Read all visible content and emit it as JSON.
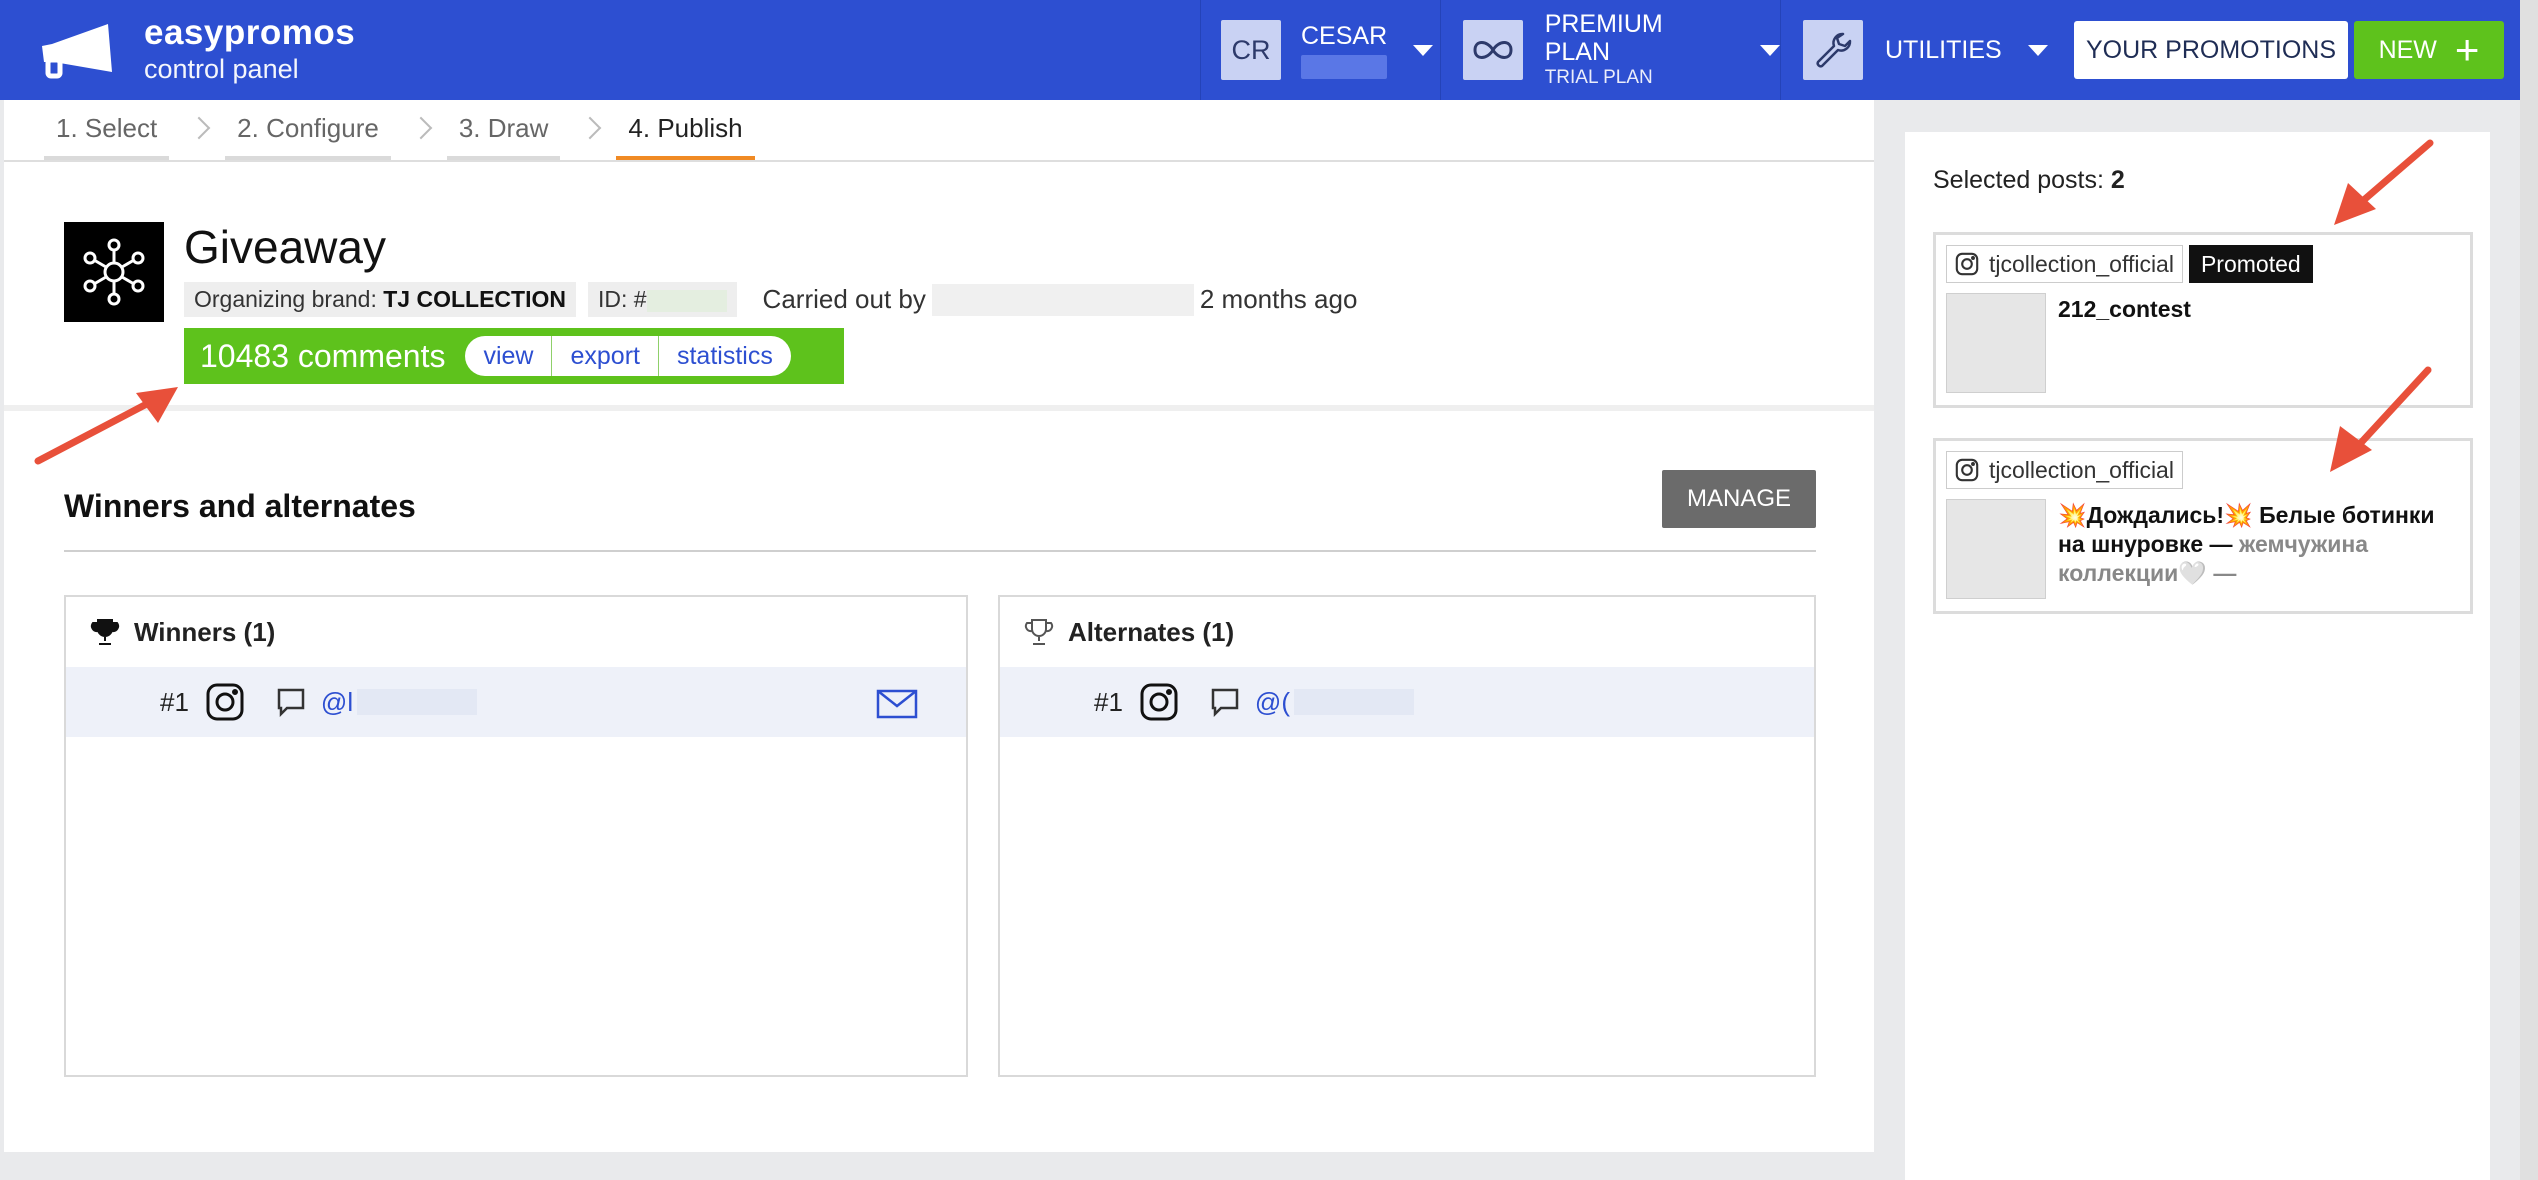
{
  "brand": {
    "name": "easypromos",
    "subtitle": "control panel"
  },
  "user": {
    "initials": "CR",
    "name": "CESAR"
  },
  "plan": {
    "title": "PREMIUM PLAN",
    "subtitle": "TRIAL PLAN"
  },
  "utilities": {
    "label": "UTILITIES"
  },
  "buttons": {
    "your_promotions": "YOUR PROMOTIONS",
    "new": "NEW",
    "new_plus": "+",
    "manage": "MANAGE"
  },
  "steps": [
    {
      "label": "1. Select"
    },
    {
      "label": "2. Configure"
    },
    {
      "label": "3. Draw"
    },
    {
      "label": "4. Publish"
    }
  ],
  "promotion": {
    "title": "Giveaway",
    "brand_label": "Organizing brand:",
    "brand_value": "TJ COLLECTION",
    "id_label": "ID: #",
    "carried_out_by": "Carried out by",
    "time_ago": "2 months ago",
    "comments_count": "10483 comments",
    "links": {
      "view": "view",
      "export": "export",
      "statistics": "statistics"
    }
  },
  "winners_section": {
    "title": "Winners and alternates",
    "winners_label": "Winners (1)",
    "alternates_label": "Alternates (1)",
    "winner_rank": "#1",
    "winner_handle": "@l",
    "alternate_rank": "#1",
    "alternate_handle": "@("
  },
  "sidebar": {
    "selected_label": "Selected posts:",
    "selected_count": "2",
    "posts": [
      {
        "account": "tjcollection_official",
        "badge": "Promoted",
        "text": "212_contest"
      },
      {
        "account": "tjcollection_official",
        "text_main": "💥Дождались!💥 Белые ботинки на шнуровке —",
        "text_fade": "жемчужина коллекции🤍 —"
      }
    ]
  },
  "colors": {
    "topbar": "#2d4fd1",
    "green": "#5ec21c",
    "accent_step": "#f08a24",
    "arrow": "#e8503a"
  }
}
